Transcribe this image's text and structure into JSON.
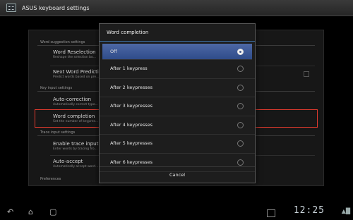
{
  "app": {
    "title": "ASUS keyboard settings"
  },
  "settings": {
    "sections": [
      {
        "header": "Word suggestion settings"
      },
      {
        "header": "Key input settings"
      },
      {
        "header": "Trace input settings"
      },
      {
        "header": "Preferences"
      }
    ],
    "items": [
      {
        "title": "Word Reselection",
        "summary": "Reshape the selection bo..."
      },
      {
        "title": "Next Word Prediction",
        "summary": "Predict words based on pre..."
      },
      {
        "title": "Auto-correction",
        "summary": "Automatically correct typo..."
      },
      {
        "title": "Word completion",
        "summary": "Set the number of keypres..."
      },
      {
        "title": "Enable trace input",
        "summary": "Enter words by tracing fro..."
      },
      {
        "title": "Auto-accept",
        "summary": "Automatically accept word..."
      }
    ]
  },
  "dialog": {
    "title": "Word completion",
    "options": [
      {
        "label": "Off",
        "selected": true
      },
      {
        "label": "After 1 keypress",
        "selected": false
      },
      {
        "label": "After 2 keypresses",
        "selected": false
      },
      {
        "label": "After 3 keypresses",
        "selected": false
      },
      {
        "label": "After 4 keypresses",
        "selected": false
      },
      {
        "label": "After 5 keypresses",
        "selected": false
      },
      {
        "label": "After 6 keypresses",
        "selected": false
      }
    ],
    "cancel_label": "Cancel"
  },
  "statusbar": {
    "time": "12:25"
  },
  "colors": {
    "highlight": "#e03a2e",
    "selected_bg": "#3f5b99",
    "dialog_accent": "#3d6fa4"
  },
  "icons": [
    "back-icon",
    "home-icon",
    "recent-apps-icon",
    "notification-tray-icon",
    "wifi-icon",
    "battery-icon"
  ]
}
